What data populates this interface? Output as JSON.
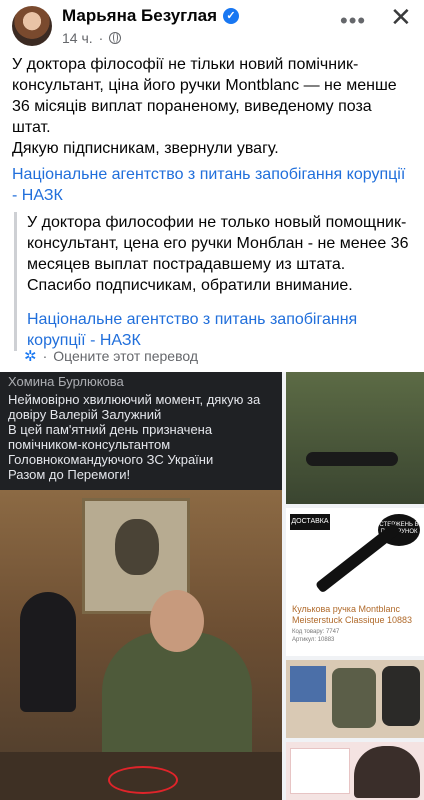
{
  "post": {
    "author": "Марьяна Безуглая",
    "time": "14 ч.",
    "more_label": "•••",
    "close_label": "✕",
    "text_line1": "У доктора філософії не тільки новий помічник-консультант, ціна його ручки Montblanc — не менше 36 місяців виплат пораненому, виведеному поза штат.",
    "text_line2": "Дякую підписникам, звернули увагу.",
    "link": "Національне агентство з питань запобігання корупції - НАЗК"
  },
  "translation": {
    "text_line1": "У доктора философии не только новый помощник-консультант, цена его ручки Монблан - не менее 36 месяцев выплат пострадавшему из штата.",
    "text_line2": "Спасибо подписчикам, обратили внимание.",
    "link": "Національне агентство з питань запобігання корупції - НАЗК",
    "rate_label": "Оцените этот перевод"
  },
  "photos": {
    "screenshot_name": "Хомина Бурлюкова",
    "screenshot_text": "Неймовірно хвилюючий момент, дякую за довіру Валерій Залужний\nВ цей пам'ятний день призначена помічником-консультантом Головнокомандуючого ЗС України\nРазом до Перемоги!",
    "delivery_badge": "ДОСТАВКА",
    "gift_badge": "СТЕРЖЕНЬ В ПОДАРУНОК",
    "pen_title": "Кулькова ручка Montblanc Meisterstuck Classique 10883",
    "pen_meta": "Код товару: 7747\nАртикул: 10883"
  },
  "colors": {
    "accent": "#1877f2",
    "link": "#216fdb",
    "circle": "#e0242a"
  }
}
